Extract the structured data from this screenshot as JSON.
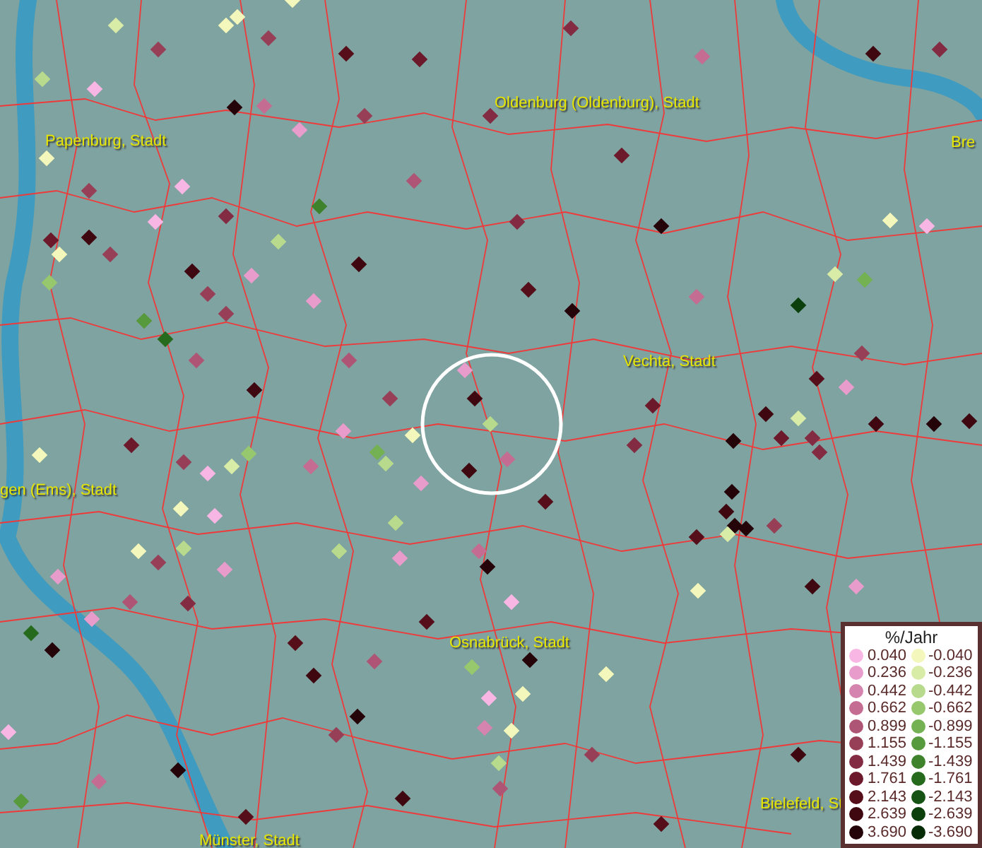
{
  "map": {
    "places": [
      {
        "name": "Oldenburg (Oldenburg), Stadt"
      },
      {
        "name": "Papenburg, Stadt"
      },
      {
        "name": "Bre"
      },
      {
        "name": "Vechta, Stadt"
      },
      {
        "name": "gen (Ems), Stadt"
      },
      {
        "name": "Osnabrück, Stadt"
      },
      {
        "name": "Bielefeld, St"
      },
      {
        "name": "Münster, Stadt"
      }
    ]
  },
  "legend": {
    "title": "%/Jahr",
    "rows": [
      {
        "positive": {
          "value": "0.040",
          "color": "#f7b6e4"
        },
        "negative": {
          "value": "-0.040",
          "color": "#f4f7bc"
        }
      },
      {
        "positive": {
          "value": "0.236",
          "color": "#e79ccb"
        },
        "negative": {
          "value": "-0.236",
          "color": "#d8eca8"
        }
      },
      {
        "positive": {
          "value": "0.442",
          "color": "#d584b0"
        },
        "negative": {
          "value": "-0.442",
          "color": "#b7da8d"
        }
      },
      {
        "positive": {
          "value": "0.662",
          "color": "#c46c92"
        },
        "negative": {
          "value": "-0.662",
          "color": "#97c86e"
        }
      },
      {
        "positive": {
          "value": "0.899",
          "color": "#ae5575"
        },
        "negative": {
          "value": "-0.899",
          "color": "#74b152"
        }
      },
      {
        "positive": {
          "value": "1.155",
          "color": "#983f58"
        },
        "negative": {
          "value": "-1.155",
          "color": "#57993d"
        }
      },
      {
        "positive": {
          "value": "1.439",
          "color": "#832b42"
        },
        "negative": {
          "value": "-1.439",
          "color": "#3e822c"
        }
      },
      {
        "positive": {
          "value": "1.761",
          "color": "#6c1a2b"
        },
        "negative": {
          "value": "-1.761",
          "color": "#256a1d"
        }
      },
      {
        "positive": {
          "value": "2.143",
          "color": "#550e1a"
        },
        "negative": {
          "value": "-2.143",
          "color": "#145314"
        }
      },
      {
        "positive": {
          "value": "2.639",
          "color": "#3f0710"
        },
        "negative": {
          "value": "-2.639",
          "color": "#0b400c"
        }
      },
      {
        "positive": {
          "value": "3.690",
          "color": "#240309"
        },
        "negative": {
          "value": "-3.690",
          "color": "#052b07"
        }
      }
    ]
  }
}
